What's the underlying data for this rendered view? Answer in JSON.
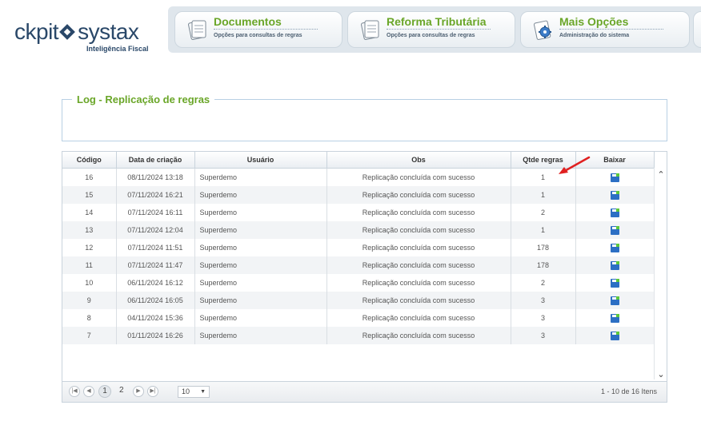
{
  "header": {
    "logo_text_left": "ckpit",
    "logo_text_right": "systax",
    "logo_tagline": "Inteligência Fiscal",
    "nav": [
      {
        "title": "Documentos",
        "subtitle": "Opções para consultas de regras",
        "icon": "document-icon"
      },
      {
        "title": "Reforma Tributária",
        "subtitle": "Opções para consultas de regras",
        "icon": "document-icon"
      },
      {
        "title": "Mais Opções",
        "subtitle": "Administração do sistema",
        "icon": "gear-icon"
      }
    ]
  },
  "log_panel": {
    "legend": "Log - Replicação de regras"
  },
  "grid": {
    "columns": [
      "Código",
      "Data de criação",
      "Usuário",
      "Obs",
      "Qtde regras",
      "Baixar"
    ],
    "rows": [
      {
        "codigo": "16",
        "data": "08/11/2024 13:18",
        "usuario": "Superdemo",
        "obs": "Replicação concluída com sucesso",
        "qtde": "1"
      },
      {
        "codigo": "15",
        "data": "07/11/2024 16:21",
        "usuario": "Superdemo",
        "obs": "Replicação concluída com sucesso",
        "qtde": "1"
      },
      {
        "codigo": "14",
        "data": "07/11/2024 16:11",
        "usuario": "Superdemo",
        "obs": "Replicação concluída com sucesso",
        "qtde": "2"
      },
      {
        "codigo": "13",
        "data": "07/11/2024 12:04",
        "usuario": "Superdemo",
        "obs": "Replicação concluída com sucesso",
        "qtde": "1"
      },
      {
        "codigo": "12",
        "data": "07/11/2024 11:51",
        "usuario": "Superdemo",
        "obs": "Replicação concluída com sucesso",
        "qtde": "178"
      },
      {
        "codigo": "11",
        "data": "07/11/2024 11:47",
        "usuario": "Superdemo",
        "obs": "Replicação concluída com sucesso",
        "qtde": "178"
      },
      {
        "codigo": "10",
        "data": "06/11/2024 16:12",
        "usuario": "Superdemo",
        "obs": "Replicação concluída com sucesso",
        "qtde": "2"
      },
      {
        "codigo": "9",
        "data": "06/11/2024 16:05",
        "usuario": "Superdemo",
        "obs": "Replicação concluída com sucesso",
        "qtde": "3"
      },
      {
        "codigo": "8",
        "data": "04/11/2024 15:36",
        "usuario": "Superdemo",
        "obs": "Replicação concluída com sucesso",
        "qtde": "3"
      },
      {
        "codigo": "7",
        "data": "01/11/2024 16:26",
        "usuario": "Superdemo",
        "obs": "Replicação concluída com sucesso",
        "qtde": "3"
      }
    ],
    "download_icon": "save-icon"
  },
  "pager": {
    "pages": [
      "1",
      "2"
    ],
    "current_page": "1",
    "page_size": "10",
    "info": "1 - 10 de 16 Itens"
  },
  "colors": {
    "accent_green": "#6aa628",
    "brand_navy": "#2a4869",
    "annotation_arrow": "#e02020"
  }
}
